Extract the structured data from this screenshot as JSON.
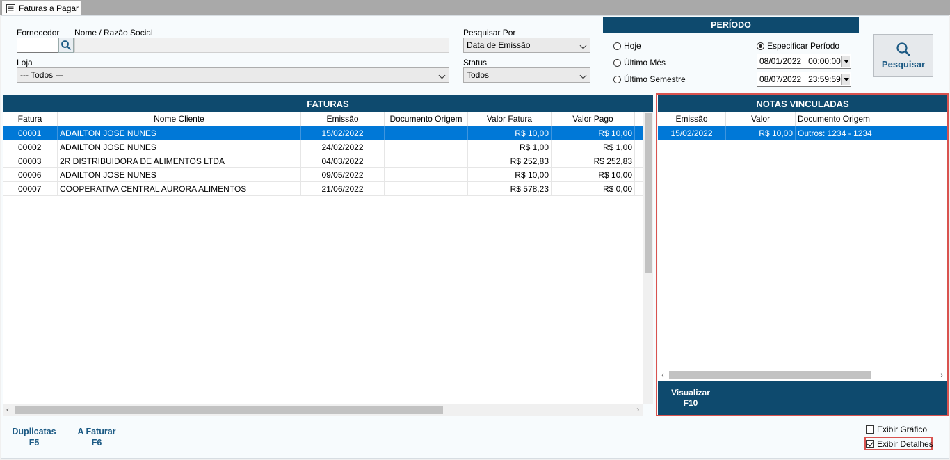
{
  "tab": {
    "label": "Faturas a Pagar"
  },
  "filters": {
    "fornecedor_label": "Fornecedor",
    "nome_label": "Nome / Razão Social",
    "fornecedor_value": "",
    "nome_value": "",
    "loja_label": "Loja",
    "loja_value": "--- Todos ---",
    "pesquisar_por_label": "Pesquisar Por",
    "pesquisar_por_value": "Data de Emissão",
    "status_label": "Status",
    "status_value": "Todos"
  },
  "periodo": {
    "title": "PERÍODO",
    "options": [
      "Hoje",
      "Último Mês",
      "Último Semestre",
      "Especificar Período"
    ],
    "selected": "Especificar Período",
    "start": {
      "date": "08/01/2022",
      "time": "00:00:00"
    },
    "end": {
      "date": "08/07/2022",
      "time": "23:59:59"
    }
  },
  "search_button": {
    "label": "Pesquisar"
  },
  "faturas": {
    "title": "FATURAS",
    "columns": [
      "Fatura",
      "Nome Cliente",
      "Emissão",
      "Documento Origem",
      "Valor Fatura",
      "Valor Pago"
    ],
    "rows": [
      {
        "fatura": "00001",
        "cliente": "ADAILTON JOSE NUNES",
        "emissao": "15/02/2022",
        "doc": "",
        "valor": "R$ 10,00",
        "pago": "R$ 10,00"
      },
      {
        "fatura": "00002",
        "cliente": "ADAILTON JOSE NUNES",
        "emissao": "24/02/2022",
        "doc": "",
        "valor": "R$ 1,00",
        "pago": "R$ 1,00"
      },
      {
        "fatura": "00003",
        "cliente": "2R DISTRIBUIDORA DE ALIMENTOS LTDA",
        "emissao": "04/03/2022",
        "doc": "",
        "valor": "R$ 252,83",
        "pago": "R$ 252,83"
      },
      {
        "fatura": "00006",
        "cliente": "ADAILTON JOSE NUNES",
        "emissao": "09/05/2022",
        "doc": "",
        "valor": "R$ 10,00",
        "pago": "R$ 10,00"
      },
      {
        "fatura": "00007",
        "cliente": "COOPERATIVA CENTRAL AURORA ALIMENTOS",
        "emissao": "21/06/2022",
        "doc": "",
        "valor": "R$ 578,23",
        "pago": "R$ 0,00"
      }
    ]
  },
  "notas": {
    "title": "NOTAS VINCULADAS",
    "columns": [
      "Emissão",
      "Valor",
      "Documento Origem"
    ],
    "rows": [
      {
        "emissao": "15/02/2022",
        "valor": "R$ 10,00",
        "doc": "Outros: 1234 - 1234"
      }
    ],
    "visualizar": {
      "label": "Visualizar",
      "key": "F10"
    }
  },
  "footer": {
    "duplicatas": {
      "label": "Duplicatas",
      "key": "F5"
    },
    "a_faturar": {
      "label": "A Faturar",
      "key": "F6"
    },
    "exibir_grafico": {
      "label": "Exibir Gráfico",
      "checked": false
    },
    "exibir_detalhes": {
      "label": "Exibir Detalhes",
      "checked": true
    }
  },
  "colors": {
    "header_bar": "#0e4a6e",
    "selection": "#0078d7",
    "highlight_border": "#d9534f"
  }
}
